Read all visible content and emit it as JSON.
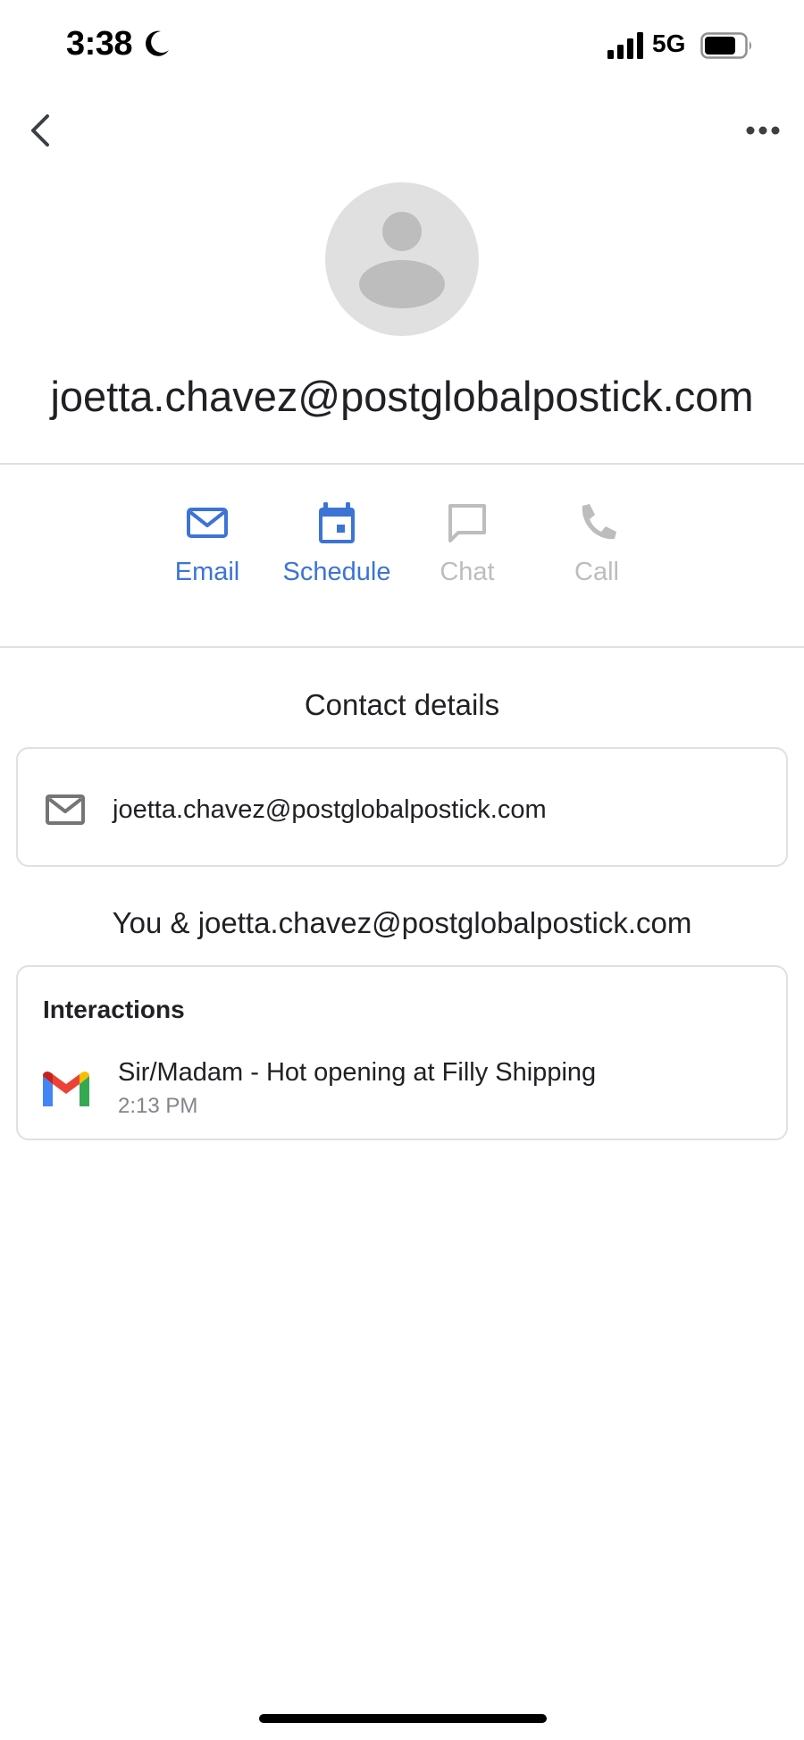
{
  "status_bar": {
    "time": "3:38",
    "network": "5G",
    "icons": [
      "moon-icon",
      "signal-icon",
      "battery-icon"
    ]
  },
  "nav": {
    "icons": [
      "back-arrow-icon",
      "more-horizontal-icon"
    ]
  },
  "contact": {
    "name": "joetta.chavez@postglobalpostick.com",
    "avatar_icon": "person-silhouette-icon"
  },
  "actions": [
    {
      "label": "Email",
      "icon": "mail-icon",
      "state": "enabled"
    },
    {
      "label": "Schedule",
      "icon": "calendar-icon",
      "state": "enabled"
    },
    {
      "label": "Chat",
      "icon": "chat-bubble-icon",
      "state": "disabled"
    },
    {
      "label": "Call",
      "icon": "phone-icon",
      "state": "disabled"
    }
  ],
  "contact_details": {
    "title": "Contact details",
    "email": "joetta.chavez@postglobalpostick.com"
  },
  "shared": {
    "title": "You & joetta.chavez@postglobalpostick.com"
  },
  "interactions": {
    "title": "Interactions",
    "items": [
      {
        "subject": "Sir/Madam - Hot opening at Filly Shipping",
        "time": "2:13 PM",
        "icon": "gmail-icon"
      }
    ]
  },
  "colors": {
    "accent": "#3c74d6",
    "disabled": "#bdbdbd",
    "divider": "#e0e0e0",
    "text": "#202124",
    "secondary_text": "#80868b"
  }
}
